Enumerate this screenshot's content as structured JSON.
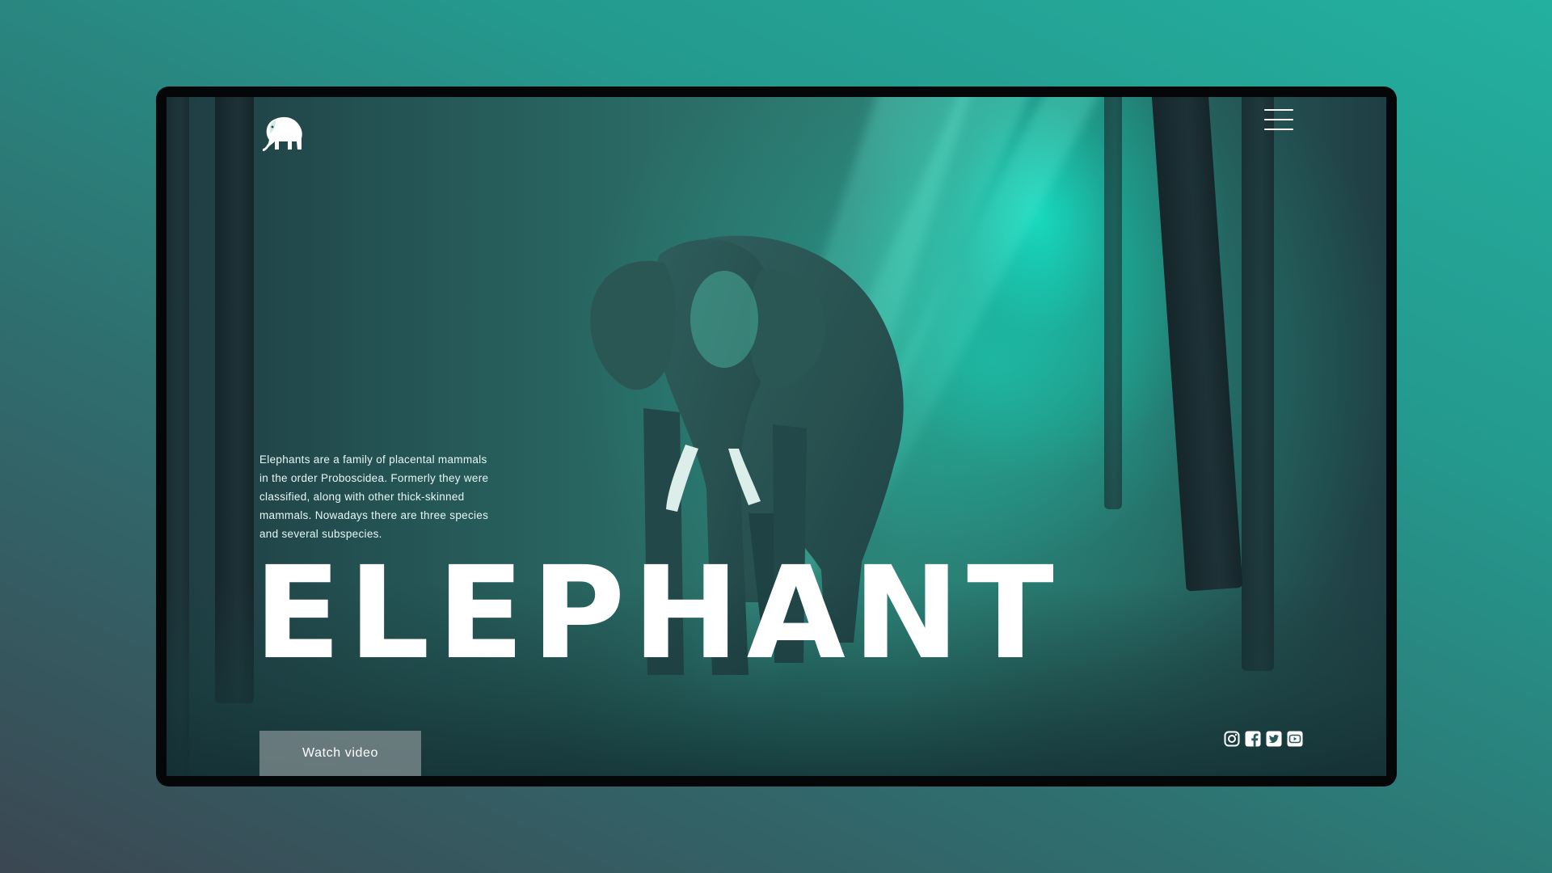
{
  "hero": {
    "title": "ELEPHANT",
    "description_lines": [
      "Elephants are a family of placental mammals",
      "in the order Proboscidea. Formerly they were",
      "classified, along with other thick-skinned",
      "mammals. Nowadays there are three species",
      "and several subspecies."
    ]
  },
  "actions": {
    "watch_video_label": "Watch video"
  },
  "header": {
    "logo_icon": "elephant-logo-icon",
    "menu_icon": "hamburger-menu-icon"
  },
  "social": {
    "icons": [
      "instagram-icon",
      "facebook-icon",
      "twitter-icon",
      "youtube-icon"
    ]
  },
  "colors": {
    "background_teal": "#23b09f",
    "background_dark": "#3b4752",
    "frame": "#050607",
    "accent_light": "#14e6c8",
    "text": "#ffffff",
    "button_fill": "#7d8c8e"
  }
}
